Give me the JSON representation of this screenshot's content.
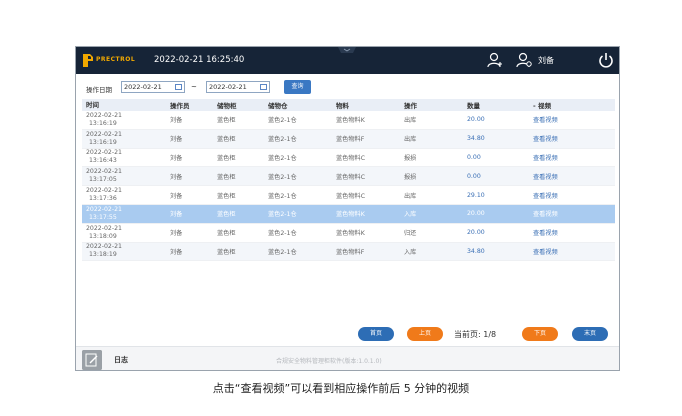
{
  "titlebar": {
    "logo_text": "PRECTROL",
    "datetime": "2022-02-21 16:25:40",
    "username": "刘备"
  },
  "filter": {
    "label": "操作日期",
    "date_from": "2022-02-21",
    "separator": "~",
    "date_to": "2022-02-21",
    "query_label": "查询"
  },
  "table": {
    "headers": [
      "时间",
      "操作员",
      "储物柜",
      "储物仓",
      "物料",
      "操作",
      "数量",
      "视频"
    ],
    "rows": [
      {
        "date": "2022-02-21",
        "time": "13:16:19",
        "operator": "刘备",
        "cabinet": "蓝色柜",
        "bin": "蓝色2-1仓",
        "material": "蓝色物料K",
        "action": "出库",
        "quantity": "20.00",
        "video": "查看视频"
      },
      {
        "date": "2022-02-21",
        "time": "13:16:19",
        "operator": "刘备",
        "cabinet": "蓝色柜",
        "bin": "蓝色2-1仓",
        "material": "蓝色物料F",
        "action": "出库",
        "quantity": "34.80",
        "video": "查看视频"
      },
      {
        "date": "2022-02-21",
        "time": "13:16:43",
        "operator": "刘备",
        "cabinet": "蓝色柜",
        "bin": "蓝色2-1仓",
        "material": "蓝色物料C",
        "action": "报损",
        "quantity": "0.00",
        "video": "查看视频"
      },
      {
        "date": "2022-02-21",
        "time": "13:17:05",
        "operator": "刘备",
        "cabinet": "蓝色柜",
        "bin": "蓝色2-1仓",
        "material": "蓝色物料C",
        "action": "报损",
        "quantity": "0.00",
        "video": "查看视频"
      },
      {
        "date": "2022-02-21",
        "time": "13:17:36",
        "operator": "刘备",
        "cabinet": "蓝色柜",
        "bin": "蓝色2-1仓",
        "material": "蓝色物料C",
        "action": "出库",
        "quantity": "29.10",
        "video": "查看视频"
      },
      {
        "date": "2022-02-21",
        "time": "13:17:55",
        "operator": "刘备",
        "cabinet": "蓝色柜",
        "bin": "蓝色2-1仓",
        "material": "蓝色物料K",
        "action": "入库",
        "quantity": "20.00",
        "video": "查看视频"
      },
      {
        "date": "2022-02-21",
        "time": "13:18:09",
        "operator": "刘备",
        "cabinet": "蓝色柜",
        "bin": "蓝色2-1仓",
        "material": "蓝色物料K",
        "action": "归还",
        "quantity": "20.00",
        "video": "查看视频"
      },
      {
        "date": "2022-02-21",
        "time": "13:18:19",
        "operator": "刘备",
        "cabinet": "蓝色柜",
        "bin": "蓝色2-1仓",
        "material": "蓝色物料F",
        "action": "入库",
        "quantity": "34.80",
        "video": "查看视频"
      }
    ],
    "selected_row": 5
  },
  "pager": {
    "first_label": "首页",
    "prev_label": "上页",
    "page_info": "当前页: 1/8",
    "next_label": "下页",
    "last_label": "末页"
  },
  "bottombar": {
    "log_label": "日志",
    "version": "合规安全物料管理柜软件(版本:1.0.1.0)"
  },
  "caption": "点击“查看视频”可以看到相应操作前后 5 分钟的视频",
  "colors": {
    "titlebar_bg": "#162437",
    "accent_blue": "#2d6db5",
    "accent_orange": "#f07a1a",
    "selected_row": "#a9cbf0",
    "logo": "#f2a900"
  },
  "icons": [
    "logo-icon",
    "user-icon",
    "user-settings-icon",
    "power-icon",
    "calendar-icon",
    "log-icon",
    "chevron-down-icon"
  ]
}
